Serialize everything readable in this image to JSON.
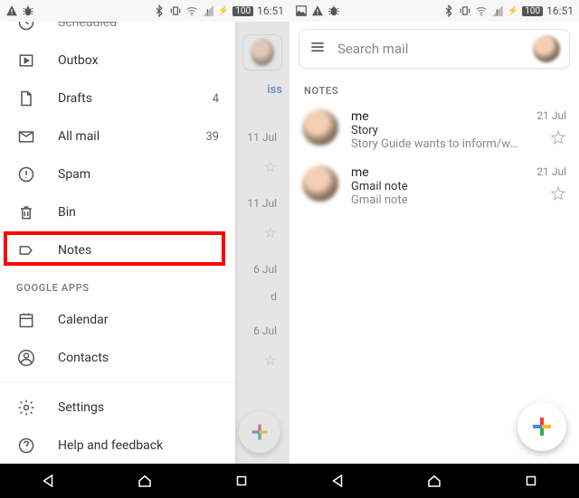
{
  "status": {
    "battery": "100",
    "time": "16:51"
  },
  "drawer": {
    "items": [
      {
        "label": "Scheduled",
        "count": ""
      },
      {
        "label": "Outbox",
        "count": ""
      },
      {
        "label": "Drafts",
        "count": "4"
      },
      {
        "label": "All mail",
        "count": "39"
      },
      {
        "label": "Spam",
        "count": ""
      },
      {
        "label": "Bin",
        "count": ""
      },
      {
        "label": "Notes",
        "count": ""
      }
    ],
    "section_google_apps": "GOOGLE APPS",
    "calendar": "Calendar",
    "contacts": "Contacts",
    "settings": "Settings",
    "help": "Help and feedback"
  },
  "behind": {
    "dismiss": "iss",
    "dates": [
      "11 Jul",
      "11 Jul",
      "6 Jul",
      "d",
      "6 Jul"
    ]
  },
  "search": {
    "placeholder": "Search mail"
  },
  "notes": {
    "section": "NOTES",
    "rows": [
      {
        "sender": "me",
        "subject": "Story",
        "snippet": "Story Guide wants to inform/warn pa…",
        "date": "21 Jul"
      },
      {
        "sender": "me",
        "subject": "Gmail note",
        "snippet": "Gmail note",
        "date": "21 Jul"
      }
    ]
  }
}
